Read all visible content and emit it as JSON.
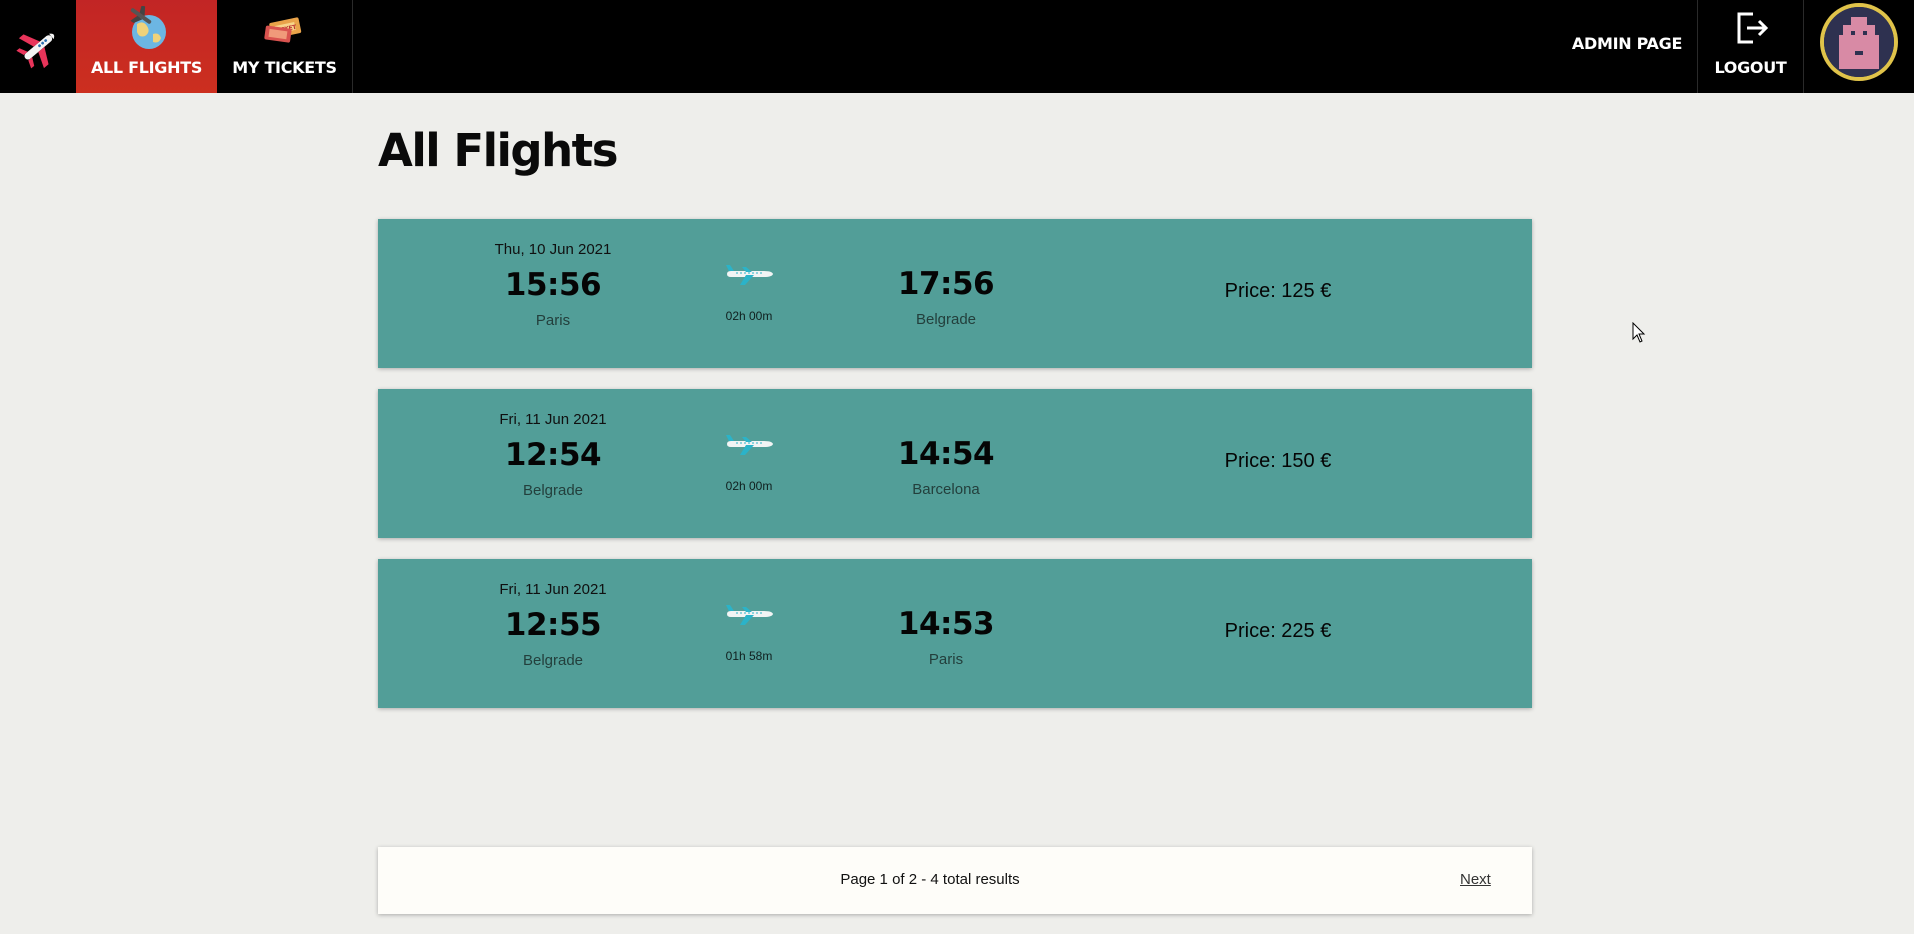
{
  "nav": {
    "logo_icon": "airplane-logo-icon",
    "items": [
      {
        "label": "ALL FLIGHTS",
        "icon": "globe-plane-icon",
        "active": true
      },
      {
        "label": "MY TICKETS",
        "icon": "tickets-icon",
        "active": false
      }
    ],
    "admin_label": "ADMIN PAGE",
    "logout_label": "LOGOUT",
    "logout_icon": "logout-icon",
    "avatar_icon": "pixel-avatar-icon",
    "active_color": "#c22525"
  },
  "page": {
    "title": "All Flights"
  },
  "flights": [
    {
      "date": "Thu, 10 Jun 2021",
      "departure_time": "15:56",
      "departure_city": "Paris",
      "duration": "02h 00m",
      "arrival_time": "17:56",
      "arrival_city": "Belgrade",
      "price_label": "Price: 125 €"
    },
    {
      "date": "Fri, 11 Jun 2021",
      "departure_time": "12:54",
      "departure_city": "Belgrade",
      "duration": "02h 00m",
      "arrival_time": "14:54",
      "arrival_city": "Barcelona",
      "price_label": "Price: 150 €"
    },
    {
      "date": "Fri, 11 Jun 2021",
      "departure_time": "12:55",
      "departure_city": "Belgrade",
      "duration": "01h 58m",
      "arrival_time": "14:53",
      "arrival_city": "Paris",
      "price_label": "Price: 225 €"
    }
  ],
  "pagination": {
    "info": "Page 1 of 2 - 4 total results",
    "next_label": "Next"
  },
  "colors": {
    "card_background": "#529e98",
    "page_background": "#eeeeeb",
    "navbar_background": "#000000"
  }
}
